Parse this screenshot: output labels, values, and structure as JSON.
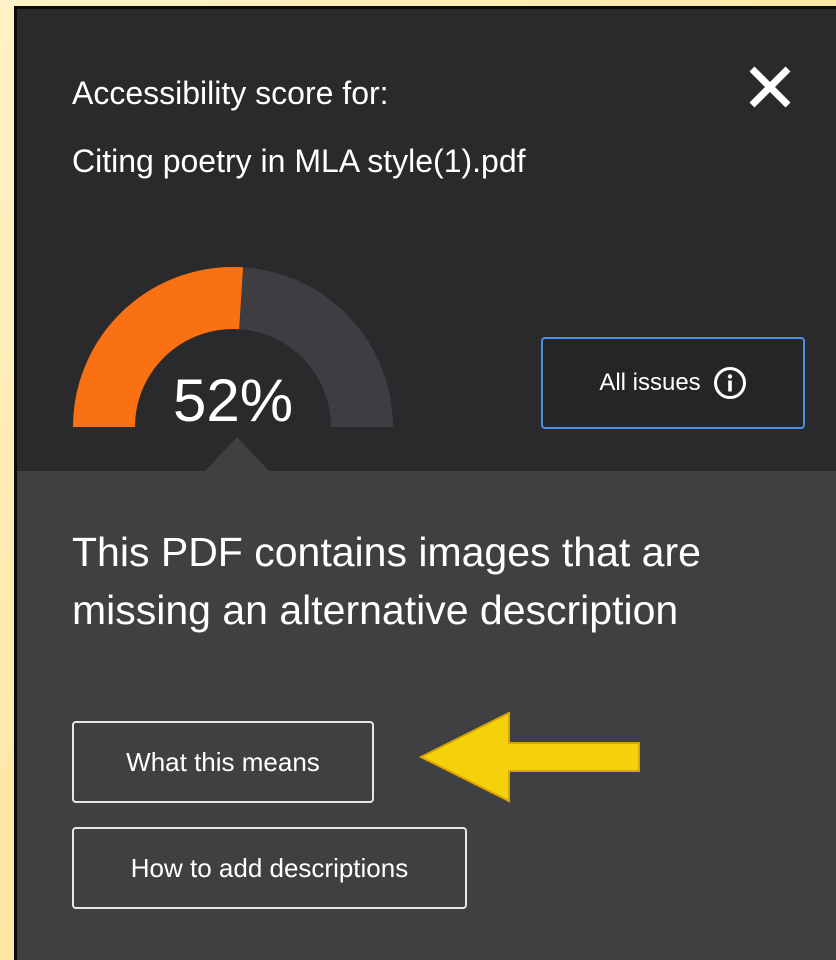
{
  "header": {
    "title": "Accessibility score for:",
    "filename": "Citing poetry in MLA style(1).pdf"
  },
  "score": {
    "percent": 52,
    "label": "52%"
  },
  "buttons": {
    "all_issues": "All issues",
    "what_this_means": "What this means",
    "how_to_add": "How to add descriptions"
  },
  "issue": {
    "message": "This PDF contains images that are missing an alternative description"
  },
  "icons": {
    "close": "close-icon",
    "info": "info-icon",
    "arrow": "annotation-arrow-icon"
  },
  "colors": {
    "gauge_fill": "#fa7113",
    "gauge_track": "#3e3e42",
    "panel_dark": "#2a2a2c",
    "panel_lower": "#404043",
    "focus_outline": "#4d8fe0",
    "annotation_yellow": "#f5d00c"
  }
}
